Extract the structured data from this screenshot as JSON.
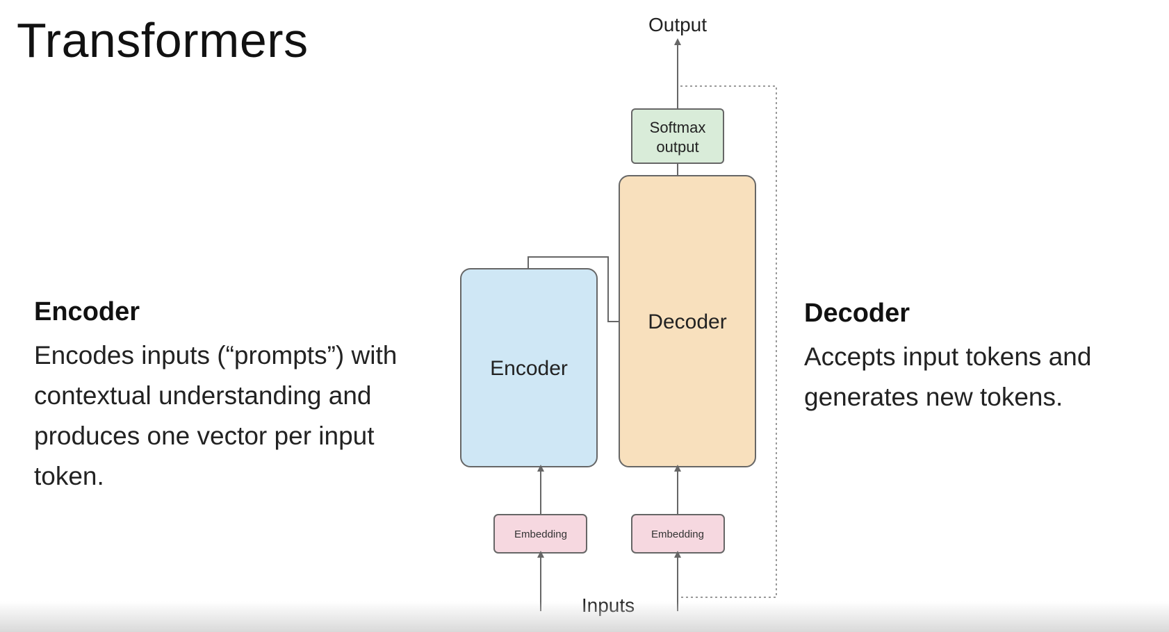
{
  "slide": {
    "title": "Transformers"
  },
  "encoder_description": {
    "heading": "Encoder",
    "body": "Encodes inputs (“prompts”) with contextual understanding and produces one vector per input token."
  },
  "decoder_description": {
    "heading": "Decoder",
    "body": "Accepts input tokens and generates new tokens."
  },
  "diagram": {
    "output_label": "Output",
    "softmax_label_line1": "Softmax",
    "softmax_label_line2": "output",
    "encoder_label": "Encoder",
    "decoder_label": "Decoder",
    "encoder_embedding_label": "Embedding",
    "decoder_embedding_label": "Embedding",
    "inputs_label": "Inputs"
  },
  "colors": {
    "encoder_fill": "#cfe7f5",
    "decoder_fill": "#f8e0bd",
    "softmax_fill": "#d9ecd9",
    "embedding_fill": "#f6d8e0",
    "stroke": "#666666"
  }
}
